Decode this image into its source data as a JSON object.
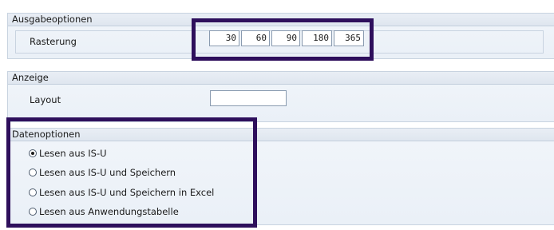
{
  "ausgabeoptionen": {
    "title": "Ausgabeoptionen",
    "rasterung_label": "Rasterung",
    "rasterung_values": [
      "30",
      "60",
      "90",
      "180",
      "365"
    ]
  },
  "anzeige": {
    "title": "Anzeige",
    "layout_label": "Layout",
    "layout_value": ""
  },
  "datenoptionen": {
    "title": "Datenoptionen",
    "options": [
      {
        "label": "Lesen aus IS-U",
        "selected": true
      },
      {
        "label": "Lesen aus IS-U und Speichern",
        "selected": false
      },
      {
        "label": "Lesen aus IS-U und Speichern in Excel",
        "selected": false
      },
      {
        "label": "Lesen aus Anwendungstabelle",
        "selected": false
      }
    ]
  },
  "colors": {
    "highlight_border": "#2e0f5c",
    "panel_background": "#eaf0f7",
    "panel_border": "#c8d3e0"
  }
}
